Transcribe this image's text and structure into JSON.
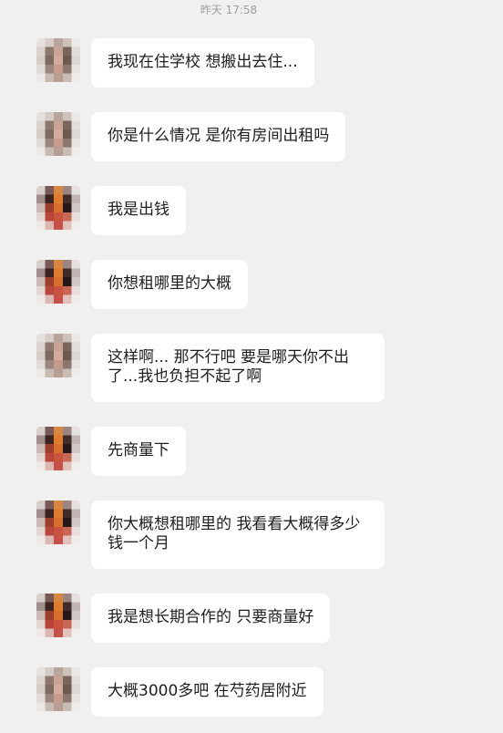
{
  "colors": {
    "background": "#f0f0f0",
    "bubble": "#ffffff",
    "text": "#1e1e1e",
    "timestamp": "#9e9e9e"
  },
  "timestamp": "昨天 17:58",
  "messages": [
    {
      "lines": [
        "我现在住学校 想搬出去住..."
      ]
    },
    {
      "lines": [
        "你是什么情况 是你有房间出租吗"
      ]
    },
    {
      "lines": [
        "我是出钱"
      ]
    },
    {
      "lines": [
        "你想租哪里的大概"
      ]
    },
    {
      "lines": [
        "这样啊... 那不行吧 要是哪天你不出",
        "了...我也负担不起了啊"
      ]
    },
    {
      "lines": [
        "先商量下"
      ]
    },
    {
      "lines": [
        "你大概想租哪里的 我看看大概得多少",
        "钱一个月"
      ]
    },
    {
      "lines": [
        "我是想长期合作的 只要商量好"
      ]
    },
    {
      "lines": [
        "大概3000多吧 在芍药居附近"
      ]
    }
  ]
}
